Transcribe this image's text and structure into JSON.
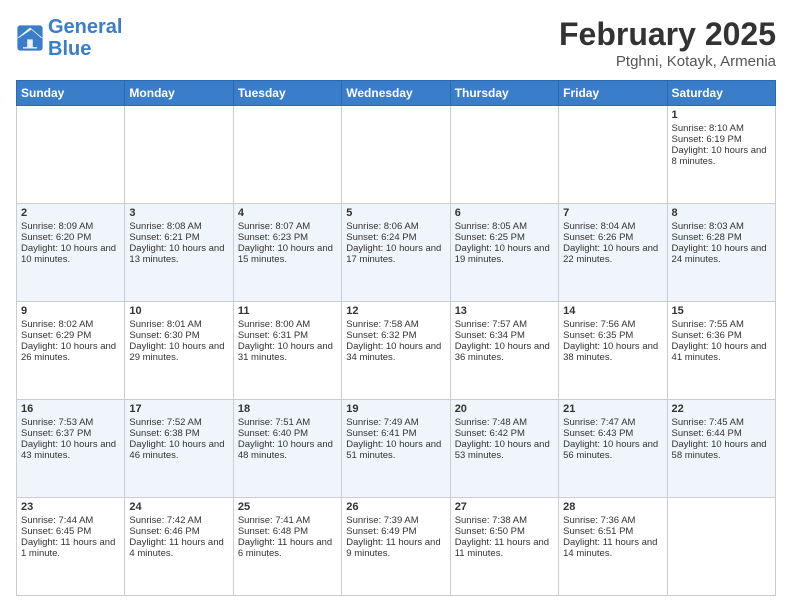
{
  "header": {
    "logo_line1": "General",
    "logo_line2": "Blue",
    "title": "February 2025",
    "subtitle": "Ptghni, Kotayk, Armenia"
  },
  "days_of_week": [
    "Sunday",
    "Monday",
    "Tuesday",
    "Wednesday",
    "Thursday",
    "Friday",
    "Saturday"
  ],
  "weeks": [
    [
      {
        "day": "",
        "info": ""
      },
      {
        "day": "",
        "info": ""
      },
      {
        "day": "",
        "info": ""
      },
      {
        "day": "",
        "info": ""
      },
      {
        "day": "",
        "info": ""
      },
      {
        "day": "",
        "info": ""
      },
      {
        "day": "1",
        "info": "Sunrise: 8:10 AM\nSunset: 6:19 PM\nDaylight: 10 hours and 8 minutes."
      }
    ],
    [
      {
        "day": "2",
        "info": "Sunrise: 8:09 AM\nSunset: 6:20 PM\nDaylight: 10 hours and 10 minutes."
      },
      {
        "day": "3",
        "info": "Sunrise: 8:08 AM\nSunset: 6:21 PM\nDaylight: 10 hours and 13 minutes."
      },
      {
        "day": "4",
        "info": "Sunrise: 8:07 AM\nSunset: 6:23 PM\nDaylight: 10 hours and 15 minutes."
      },
      {
        "day": "5",
        "info": "Sunrise: 8:06 AM\nSunset: 6:24 PM\nDaylight: 10 hours and 17 minutes."
      },
      {
        "day": "6",
        "info": "Sunrise: 8:05 AM\nSunset: 6:25 PM\nDaylight: 10 hours and 19 minutes."
      },
      {
        "day": "7",
        "info": "Sunrise: 8:04 AM\nSunset: 6:26 PM\nDaylight: 10 hours and 22 minutes."
      },
      {
        "day": "8",
        "info": "Sunrise: 8:03 AM\nSunset: 6:28 PM\nDaylight: 10 hours and 24 minutes."
      }
    ],
    [
      {
        "day": "9",
        "info": "Sunrise: 8:02 AM\nSunset: 6:29 PM\nDaylight: 10 hours and 26 minutes."
      },
      {
        "day": "10",
        "info": "Sunrise: 8:01 AM\nSunset: 6:30 PM\nDaylight: 10 hours and 29 minutes."
      },
      {
        "day": "11",
        "info": "Sunrise: 8:00 AM\nSunset: 6:31 PM\nDaylight: 10 hours and 31 minutes."
      },
      {
        "day": "12",
        "info": "Sunrise: 7:58 AM\nSunset: 6:32 PM\nDaylight: 10 hours and 34 minutes."
      },
      {
        "day": "13",
        "info": "Sunrise: 7:57 AM\nSunset: 6:34 PM\nDaylight: 10 hours and 36 minutes."
      },
      {
        "day": "14",
        "info": "Sunrise: 7:56 AM\nSunset: 6:35 PM\nDaylight: 10 hours and 38 minutes."
      },
      {
        "day": "15",
        "info": "Sunrise: 7:55 AM\nSunset: 6:36 PM\nDaylight: 10 hours and 41 minutes."
      }
    ],
    [
      {
        "day": "16",
        "info": "Sunrise: 7:53 AM\nSunset: 6:37 PM\nDaylight: 10 hours and 43 minutes."
      },
      {
        "day": "17",
        "info": "Sunrise: 7:52 AM\nSunset: 6:38 PM\nDaylight: 10 hours and 46 minutes."
      },
      {
        "day": "18",
        "info": "Sunrise: 7:51 AM\nSunset: 6:40 PM\nDaylight: 10 hours and 48 minutes."
      },
      {
        "day": "19",
        "info": "Sunrise: 7:49 AM\nSunset: 6:41 PM\nDaylight: 10 hours and 51 minutes."
      },
      {
        "day": "20",
        "info": "Sunrise: 7:48 AM\nSunset: 6:42 PM\nDaylight: 10 hours and 53 minutes."
      },
      {
        "day": "21",
        "info": "Sunrise: 7:47 AM\nSunset: 6:43 PM\nDaylight: 10 hours and 56 minutes."
      },
      {
        "day": "22",
        "info": "Sunrise: 7:45 AM\nSunset: 6:44 PM\nDaylight: 10 hours and 58 minutes."
      }
    ],
    [
      {
        "day": "23",
        "info": "Sunrise: 7:44 AM\nSunset: 6:45 PM\nDaylight: 11 hours and 1 minute."
      },
      {
        "day": "24",
        "info": "Sunrise: 7:42 AM\nSunset: 6:46 PM\nDaylight: 11 hours and 4 minutes."
      },
      {
        "day": "25",
        "info": "Sunrise: 7:41 AM\nSunset: 6:48 PM\nDaylight: 11 hours and 6 minutes."
      },
      {
        "day": "26",
        "info": "Sunrise: 7:39 AM\nSunset: 6:49 PM\nDaylight: 11 hours and 9 minutes."
      },
      {
        "day": "27",
        "info": "Sunrise: 7:38 AM\nSunset: 6:50 PM\nDaylight: 11 hours and 11 minutes."
      },
      {
        "day": "28",
        "info": "Sunrise: 7:36 AM\nSunset: 6:51 PM\nDaylight: 11 hours and 14 minutes."
      },
      {
        "day": "",
        "info": ""
      }
    ]
  ]
}
